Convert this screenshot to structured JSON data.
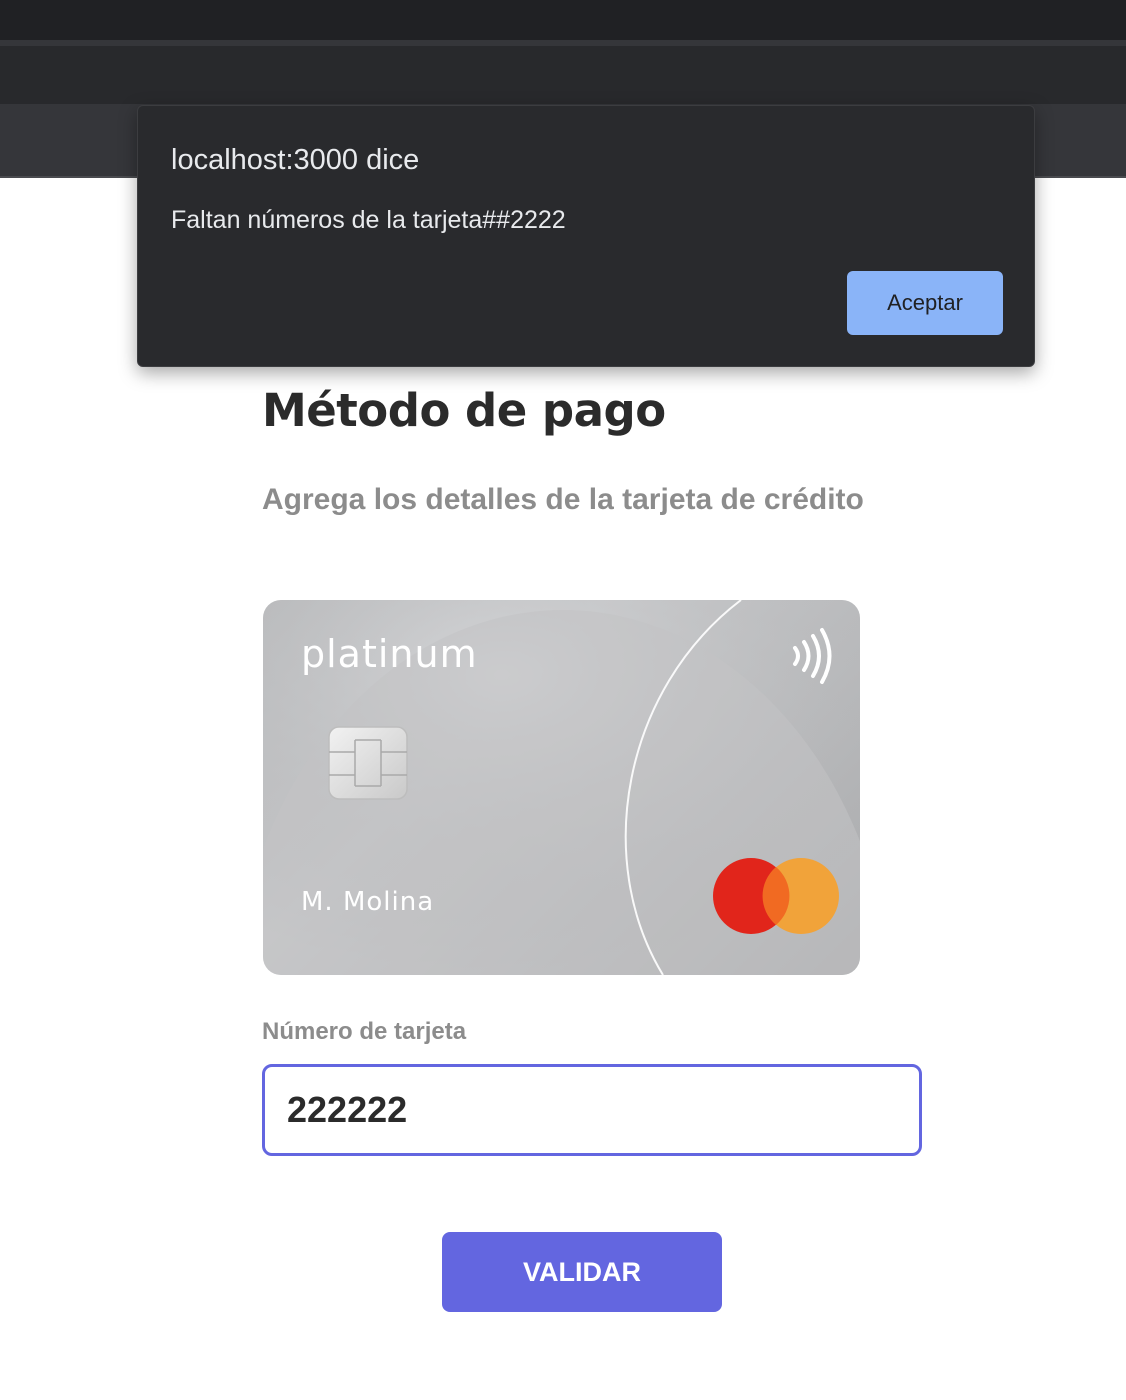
{
  "dialog": {
    "title": "localhost:3000 dice",
    "message": "Faltan números de la tarjeta##2222",
    "ok_label": "Aceptar"
  },
  "page": {
    "title": "Método de pago",
    "subtitle": "Agrega los detalles de la tarjeta de crédito"
  },
  "card": {
    "brand_text": "platinum",
    "holder_name": "M. Molina",
    "network_icon": "mastercard-logo",
    "contactless_icon": "contactless-icon",
    "chip_icon": "emv-chip-icon"
  },
  "form": {
    "card_number_label": "Número de tarjeta",
    "card_number_value": "222222",
    "submit_label": "VALIDAR"
  },
  "colors": {
    "accent": "#6366e0",
    "dialog_button": "#8ab4f8",
    "mastercard_red": "#e1251b",
    "mastercard_orange": "#f1a33a"
  }
}
